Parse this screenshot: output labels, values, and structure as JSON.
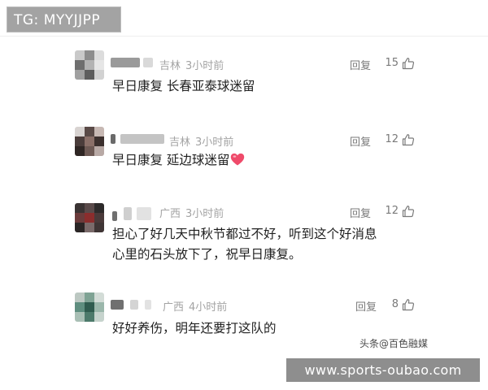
{
  "watermark_top": "TG: MYYJJPP",
  "watermark_bottom": "www.sports-oubao.com",
  "credit": "头条@百色融媒",
  "comments": [
    {
      "location": "吉林",
      "time": "3小时前",
      "reply_label": "回复",
      "likes": "15",
      "text": "早日康复 长春亚泰球迷留"
    },
    {
      "location": "吉林",
      "time": "3小时前",
      "reply_label": "回复",
      "likes": "12",
      "text": "早日康复 延边球迷留",
      "emoji": "heart-icon"
    },
    {
      "location": "广西",
      "time": "3小时前",
      "reply_label": "回复",
      "likes": "12",
      "text_line1": "担心了好几天中秋节都过不好，听到这个好消息",
      "text_line2": "心里的石头放下了，祝早日康复。"
    },
    {
      "location": "广西",
      "time": "4小时前",
      "reply_label": "回复",
      "likes": "8",
      "text": "好好养伤，明年还要打这队的"
    }
  ],
  "colors": {
    "meta": "#a3a3a3",
    "reply": "#7a7a7a",
    "text": "#1f1f1f",
    "heart": "#ef4a6a"
  }
}
